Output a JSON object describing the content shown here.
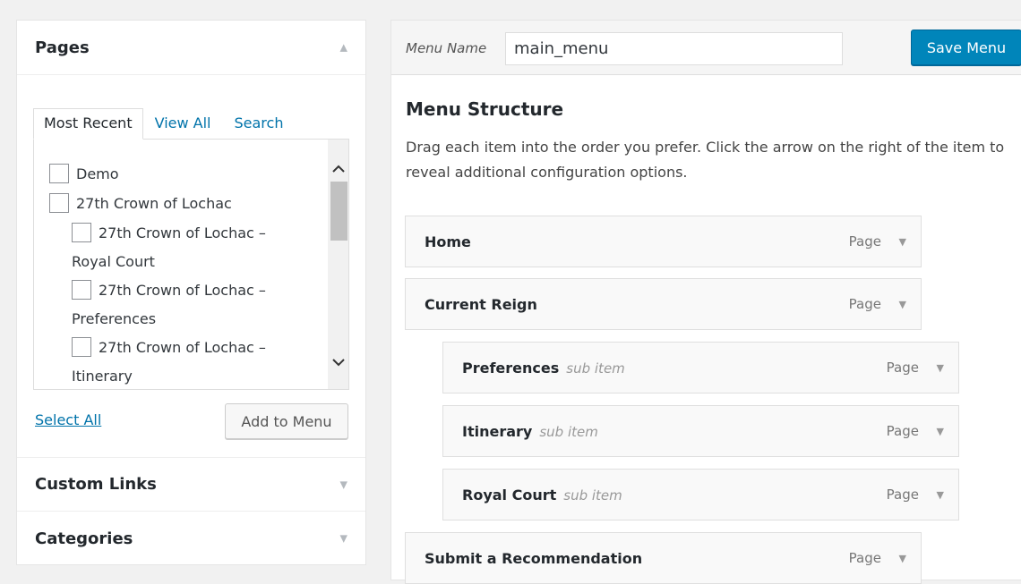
{
  "left": {
    "pages_title": "Pages",
    "tabs": [
      "Most Recent",
      "View All",
      "Search"
    ],
    "page_items": [
      {
        "label": "Demo",
        "level": 0
      },
      {
        "label": "27th Crown of Lochac",
        "level": 0
      },
      {
        "label": "27th Crown of Lochac –",
        "cont": "Royal Court",
        "level": 1
      },
      {
        "label": "27th Crown of Lochac –",
        "cont": "Preferences",
        "level": 1
      },
      {
        "label": "27th Crown of Lochac –",
        "cont": "Itinerary",
        "level": 1
      }
    ],
    "select_all": "Select All",
    "add_to_menu": "Add to Menu",
    "custom_links_title": "Custom Links",
    "categories_title": "Categories"
  },
  "right": {
    "menu_name_label": "Menu Name",
    "menu_name_value": "main_menu",
    "save_menu": "Save Menu",
    "structure_title": "Menu Structure",
    "structure_desc": "Drag each item into the order you prefer. Click the arrow on the right of the item to reveal additional configuration options.",
    "menu_items": [
      {
        "title": "Home",
        "sub": "",
        "type": "Page",
        "depth": 0
      },
      {
        "title": "Current Reign",
        "sub": "",
        "type": "Page",
        "depth": 0
      },
      {
        "title": "Preferences",
        "sub": "sub item",
        "type": "Page",
        "depth": 1
      },
      {
        "title": "Itinerary",
        "sub": "sub item",
        "type": "Page",
        "depth": 1
      },
      {
        "title": "Royal Court",
        "sub": "sub item",
        "type": "Page",
        "depth": 1
      },
      {
        "title": "Submit a Recommendation",
        "sub": "",
        "type": "Page",
        "depth": 0
      }
    ]
  },
  "colors": {
    "accent": "#0085ba",
    "link": "#0073aa"
  },
  "icons": [
    "arrow-up-icon",
    "arrow-down-icon",
    "chevron-up-icon",
    "chevron-down-icon",
    "checkbox-icon"
  ]
}
